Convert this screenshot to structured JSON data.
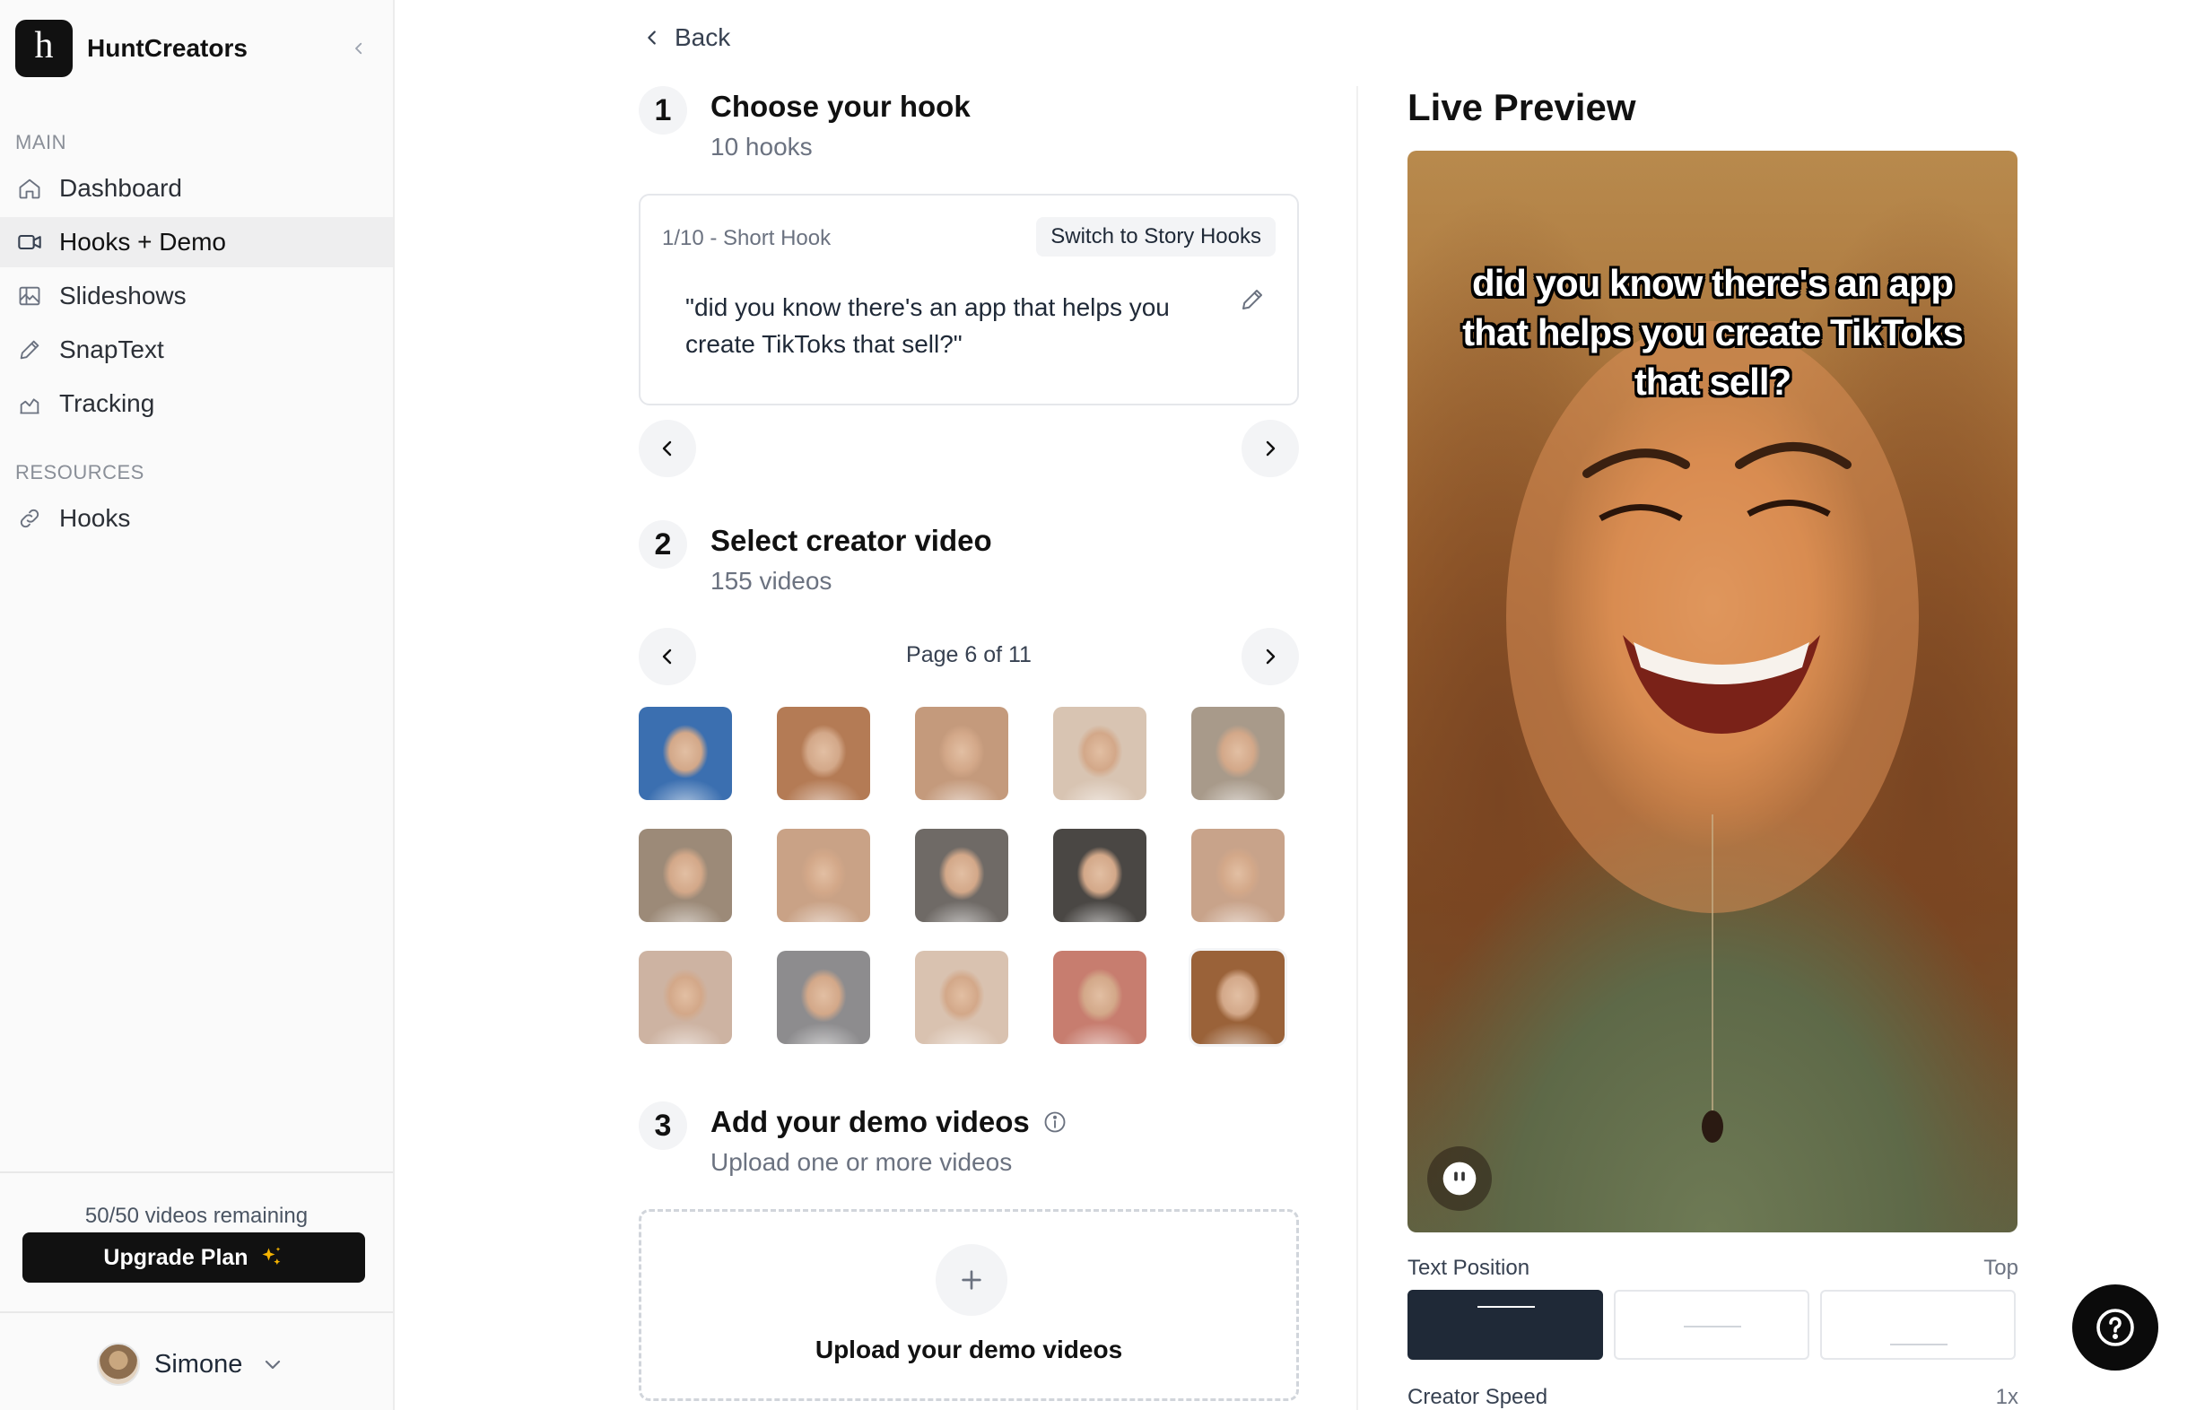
{
  "app": {
    "brand_letter": "h",
    "brand_name": "HuntCreators"
  },
  "sidebar": {
    "section_main": "MAIN",
    "section_resources": "RESOURCES",
    "items": [
      {
        "label": "Dashboard",
        "icon": "home-icon"
      },
      {
        "label": "Hooks + Demo",
        "icon": "video-camera-icon",
        "active": true
      },
      {
        "label": "Slideshows",
        "icon": "image-icon"
      },
      {
        "label": "SnapText",
        "icon": "pencil-icon"
      },
      {
        "label": "Tracking",
        "icon": "chart-icon"
      }
    ],
    "resources": [
      {
        "label": "Hooks",
        "icon": "link-icon"
      }
    ],
    "remaining": "50/50 videos remaining",
    "upgrade_label": "Upgrade Plan",
    "upgrade_icon": "sparkles-icon",
    "user_name": "Simone"
  },
  "main": {
    "back_label": "Back",
    "step1": {
      "number": "1",
      "title": "Choose your hook",
      "subtitle": "10 hooks",
      "hook_meta": "1/10 - Short Hook",
      "switch_label": "Switch to Story Hooks",
      "hook_text": "\"did you know there's an app that helps you create TikToks that sell?\""
    },
    "step2": {
      "number": "2",
      "title": "Select creator video",
      "subtitle": "155 videos",
      "page_label": "Page 6 of 11",
      "thumbnails": [
        {
          "name": "creator-1",
          "color": "#3b6fb0"
        },
        {
          "name": "creator-2",
          "color": "#b47b55"
        },
        {
          "name": "creator-3",
          "color": "#c49a7c"
        },
        {
          "name": "creator-4",
          "color": "#d8c4b2"
        },
        {
          "name": "creator-5",
          "color": "#a89a8a"
        },
        {
          "name": "creator-6",
          "color": "#9c8a78"
        },
        {
          "name": "creator-7",
          "color": "#c9a286"
        },
        {
          "name": "creator-8",
          "color": "#6f6a66"
        },
        {
          "name": "creator-9",
          "color": "#4a4744"
        },
        {
          "name": "creator-10",
          "color": "#c8a38a"
        },
        {
          "name": "creator-11",
          "color": "#cdb3a2"
        },
        {
          "name": "creator-12",
          "color": "#8d8c8e"
        },
        {
          "name": "creator-13",
          "color": "#d9c2b0"
        },
        {
          "name": "creator-14",
          "color": "#c77d6f"
        },
        {
          "name": "creator-15",
          "color": "#9a6239"
        }
      ]
    },
    "step3": {
      "number": "3",
      "title": "Add your demo videos",
      "subtitle": "Upload one or more videos",
      "upload_label": "Upload your demo videos"
    }
  },
  "preview": {
    "title": "Live Preview",
    "overlay_text": "did you know there's an app that helps you create TikToks that sell?",
    "text_position_label": "Text Position",
    "text_position_value": "Top",
    "creator_speed_label": "Creator Speed",
    "creator_speed_value": "1x"
  }
}
